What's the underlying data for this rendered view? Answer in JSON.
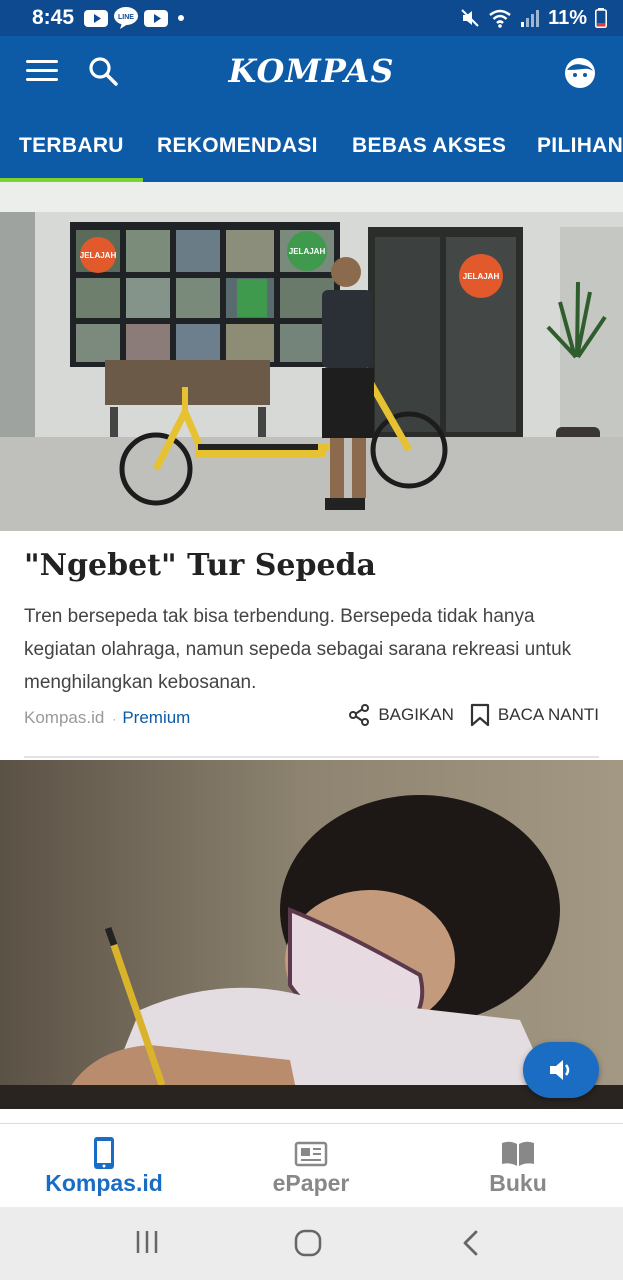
{
  "status_bar": {
    "time": "8:45",
    "battery": "11%",
    "icons": [
      "youtube-icon",
      "line-icon",
      "youtube-icon",
      "dot-icon",
      "mute-icon",
      "wifi-icon",
      "signal-icon",
      "battery-icon"
    ]
  },
  "header": {
    "logo": "KOMPAS",
    "menu_icon": "hamburger-icon",
    "search_icon": "search-icon",
    "profile_icon": "profile-icon"
  },
  "tabs": [
    {
      "label": "TERBARU",
      "active": true
    },
    {
      "label": "REKOMENDASI",
      "active": false
    },
    {
      "label": "BEBAS AKSES",
      "active": false
    },
    {
      "label": "PILIHAN",
      "active": false
    }
  ],
  "articles": [
    {
      "title": "\"Ngebet\" Tur Sepeda",
      "description": "Tren bersepeda tak bisa terbendung. Bersepeda tidak hanya kegiatan olahraga, namun sepeda sebagai sarana rekreasi untuk menghilangkan kebosanan.",
      "source": "Kompas.id",
      "separator": "·",
      "badge": "Premium",
      "share_label": "BAGIKAN",
      "read_later_label": "BACA NANTI",
      "image": "man-with-yellow-cargo-bike-photo",
      "shop_signs": [
        "JELAJAH",
        "JELAJAH",
        "JELAJAH"
      ]
    },
    {
      "image": "girl-with-mask-writing-photo"
    }
  ],
  "audio_button": {
    "icon": "speaker-icon"
  },
  "bottom_nav": [
    {
      "label": "Kompas.id",
      "icon": "phone-icon",
      "active": true
    },
    {
      "label": "ePaper",
      "icon": "newspaper-icon",
      "active": false
    },
    {
      "label": "Buku",
      "icon": "book-icon",
      "active": false
    }
  ],
  "system_nav": [
    "recents-icon",
    "home-icon",
    "back-icon"
  ],
  "colors": {
    "header_blue": "#0d5aa7",
    "status_blue": "#0d4a8f",
    "tab_indicator": "#7bd42e",
    "accent_blue": "#1a6dc3",
    "premium_blue": "#0d5aa7"
  }
}
